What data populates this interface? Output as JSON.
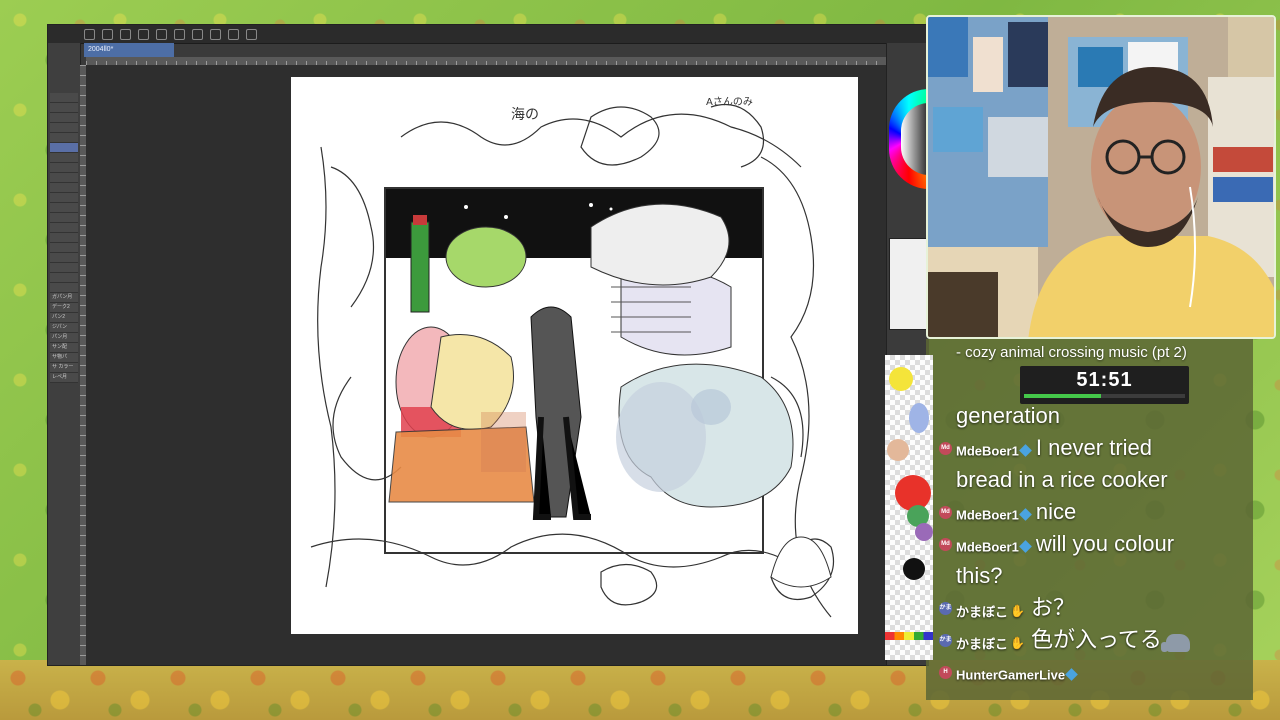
{
  "app": {
    "doc_tab": "2004ll0*",
    "left_panel_rows": [
      "",
      "",
      "",
      "",
      "",
      "",
      "",
      "",
      "",
      "",
      "",
      "",
      "",
      "",
      "",
      "",
      "",
      "",
      "",
      "",
      "ガパン月",
      "デーク2",
      "パン2",
      "ジパン",
      "パン月",
      "サン配",
      "サ物パ",
      "サ カラー",
      "レペ月"
    ]
  },
  "overlay": {
    "music": "- cozy animal crossing music (pt 2)",
    "timer": "51:51",
    "timer_progress": 0.48
  },
  "chat": {
    "messages": [
      {
        "user": "",
        "text": "generation",
        "badge": false
      },
      {
        "user": "MdeBoer1",
        "text": "I never tried",
        "badge": true,
        "badge_text": "Md"
      },
      {
        "user": "",
        "text": "bread in a rice cooker",
        "badge": false
      },
      {
        "user": "MdeBoer1",
        "text": "nice",
        "badge": true,
        "badge_text": "Md"
      },
      {
        "user": "MdeBoer1",
        "text": "will you colour",
        "badge": true,
        "badge_text": "Md"
      },
      {
        "user": "",
        "text": "this?",
        "badge": false
      },
      {
        "user": "かまぼこ",
        "text": "お？",
        "badge": true,
        "badge_text": "かま"
      },
      {
        "user": "かまぼこ",
        "text": "色が入ってる",
        "badge": true,
        "badge_text": "かま"
      },
      {
        "user": "HunterGamerLive",
        "text": "",
        "badge": true,
        "badge_text": "H"
      }
    ]
  },
  "colors": {
    "accent_green": "#45c84a",
    "overlay_bg": "#5c6634",
    "badge_md": "#c24a5a"
  },
  "icons": [
    "gem-icon",
    "hand-icon",
    "elephant-emoji-icon",
    "avatar-icon"
  ]
}
